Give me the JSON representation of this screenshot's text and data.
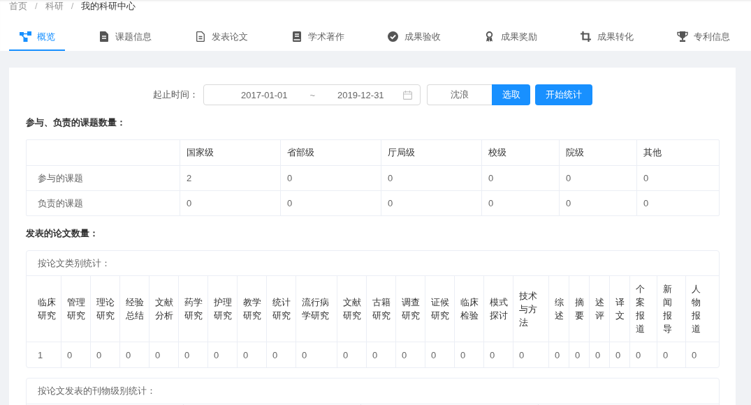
{
  "breadcrumb": {
    "items": [
      {
        "label": "首页",
        "current": false
      },
      {
        "label": "科研",
        "current": false
      },
      {
        "label": "我的科研中心",
        "current": true
      }
    ],
    "separators": [
      "/",
      "/"
    ]
  },
  "tabs": [
    {
      "label": "概览",
      "selected": true
    },
    {
      "label": "课题信息",
      "selected": false
    },
    {
      "label": "发表论文",
      "selected": false
    },
    {
      "label": "学术著作",
      "selected": false
    },
    {
      "label": "成果验收",
      "selected": false
    },
    {
      "label": "成果奖励",
      "selected": false
    },
    {
      "label": "成果转化",
      "selected": false
    },
    {
      "label": "专利信息",
      "selected": false
    }
  ],
  "filter": {
    "label": "起止时间：",
    "start_date": "2017-01-01",
    "range_separator": "~",
    "end_date": "2019-12-31",
    "person": "沈浪",
    "select_button": "选取",
    "start_button": "开始统计"
  },
  "projects": {
    "title": "参与、负责的课题数量：",
    "columns": [
      "国家级",
      "省部级",
      "厅局级",
      "校级",
      "院级",
      "其他"
    ],
    "rows": [
      {
        "label": "参与的课题",
        "values": [
          "2",
          "0",
          "0",
          "0",
          "0",
          "0"
        ]
      },
      {
        "label": "负责的课题",
        "values": [
          "0",
          "0",
          "0",
          "0",
          "0",
          "0"
        ]
      }
    ]
  },
  "papers": {
    "title": "发表的论文数量：",
    "by_type": {
      "title": "按论文类别统计：",
      "columns": [
        "临床研究",
        "管理研究",
        "理论研究",
        "经验总结",
        "文献分析",
        "药学研究",
        "护理研究",
        "教学研究",
        "统计研究",
        "流行病学研究",
        "文献研究",
        "古籍研究",
        "调查研究",
        "证候研究",
        "临床检验",
        "模式探讨",
        "技术与方法",
        "综述",
        "摘要",
        "述评",
        "译文",
        "个案报道",
        "新闻报导",
        "人物报道"
      ],
      "values": [
        "1",
        "0",
        "0",
        "0",
        "0",
        "0",
        "0",
        "0",
        "0",
        "0",
        "0",
        "0",
        "0",
        "0",
        "0",
        "0",
        "0",
        "0",
        "0",
        "0",
        "0",
        "0",
        "0",
        "0"
      ]
    },
    "by_journal": {
      "title": "按论文发表的刊物级别统计："
    }
  }
}
